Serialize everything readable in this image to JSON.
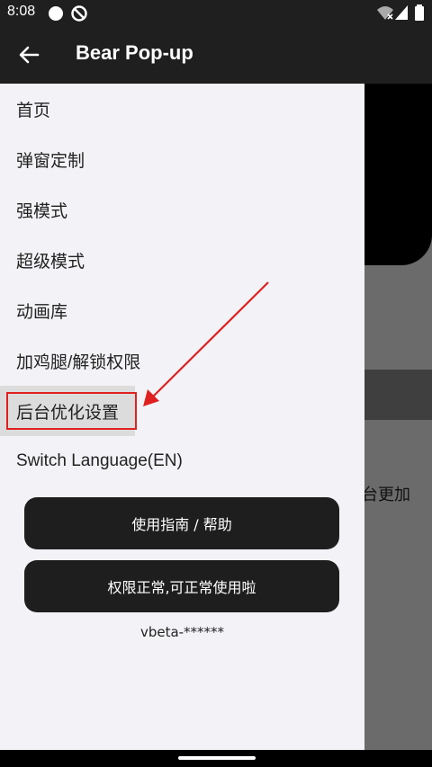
{
  "status_bar": {
    "time": "8:08",
    "icons": [
      "circle-icon",
      "do-not-disturb-icon",
      "wifi-icon",
      "signal-icon",
      "battery-icon"
    ]
  },
  "app_bar": {
    "title": "Bear Pop-up",
    "back_icon": "arrow-left-icon"
  },
  "background": {
    "partial_text": "台更加"
  },
  "drawer": {
    "items": [
      {
        "label": "首页"
      },
      {
        "label": "弹窗定制"
      },
      {
        "label": "强模式"
      },
      {
        "label": "超级模式"
      },
      {
        "label": "动画库"
      },
      {
        "label": "加鸡腿/解锁权限"
      },
      {
        "label": "后台优化设置",
        "highlighted": true
      },
      {
        "label": "Switch Language(EN)"
      }
    ],
    "buttons": [
      {
        "label": "使用指南 / 帮助"
      },
      {
        "label": "权限正常,可正常使用啦"
      }
    ],
    "version": "vbeta-******"
  },
  "annotation": {
    "color": "#e02020"
  },
  "colors": {
    "bar": "#1f1f1f",
    "drawer_bg": "#f3f3f7",
    "button_bg": "#1e1e1e",
    "scrim": "#6b6b6b"
  }
}
